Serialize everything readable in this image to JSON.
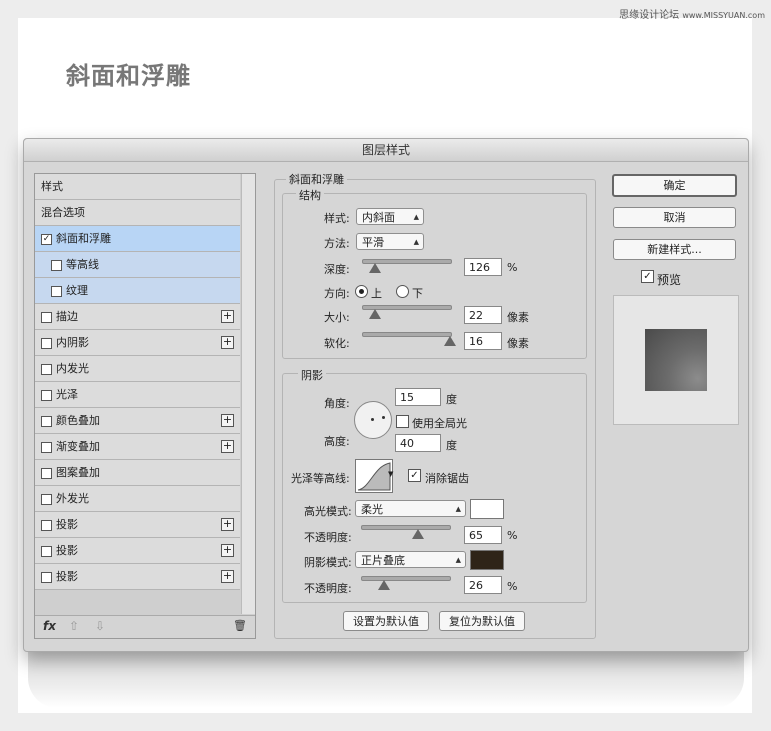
{
  "watermark": {
    "site": "思缘设计论坛",
    "url": "www.MISSYUAN.com"
  },
  "page_heading": "斜面和浮雕",
  "dialog": {
    "title": "图层样式",
    "styles": [
      {
        "label": "样式",
        "checkbox": false,
        "plus": false
      },
      {
        "label": "混合选项",
        "checkbox": false,
        "plus": false
      },
      {
        "label": "斜面和浮雕",
        "checkbox": true,
        "checked": true,
        "plus": false,
        "selected": true
      },
      {
        "label": "等高线",
        "checkbox": true,
        "checked": false,
        "plus": false,
        "sub": true
      },
      {
        "label": "纹理",
        "checkbox": true,
        "checked": false,
        "plus": false,
        "sub": true
      },
      {
        "label": "描边",
        "checkbox": true,
        "checked": false,
        "plus": true
      },
      {
        "label": "内阴影",
        "checkbox": true,
        "checked": false,
        "plus": true
      },
      {
        "label": "内发光",
        "checkbox": true,
        "checked": false,
        "plus": false
      },
      {
        "label": "光泽",
        "checkbox": true,
        "checked": false,
        "plus": false
      },
      {
        "label": "颜色叠加",
        "checkbox": true,
        "checked": false,
        "plus": true
      },
      {
        "label": "渐变叠加",
        "checkbox": true,
        "checked": false,
        "plus": true
      },
      {
        "label": "图案叠加",
        "checkbox": true,
        "checked": false,
        "plus": false
      },
      {
        "label": "外发光",
        "checkbox": true,
        "checked": false,
        "plus": false
      },
      {
        "label": "投影",
        "checkbox": true,
        "checked": false,
        "plus": true
      },
      {
        "label": "投影",
        "checkbox": true,
        "checked": false,
        "plus": true
      },
      {
        "label": "投影",
        "checkbox": true,
        "checked": false,
        "plus": true
      }
    ],
    "footer": {
      "fx": "fx",
      "up": "⇧",
      "down": "⇩",
      "trash": "🗑"
    },
    "bevel": {
      "group_title": "斜面和浮雕",
      "structure_title": "结构",
      "style_label": "样式:",
      "style_value": "内斜面",
      "method_label": "方法:",
      "method_value": "平滑",
      "depth_label": "深度:",
      "depth_value": "126",
      "depth_unit": "%",
      "depth_slider": 0.15,
      "direction_label": "方向:",
      "direction_up": "上",
      "direction_down": "下",
      "direction_selected": "上",
      "size_label": "大小:",
      "size_value": "22",
      "size_unit": "像素",
      "size_slider": 0.15,
      "soften_label": "软化:",
      "soften_value": "16",
      "soften_unit": "像素",
      "soften_slider": 1.0
    },
    "shading": {
      "title": "阴影",
      "angle_label": "角度:",
      "angle_value": "15",
      "angle_unit": "度",
      "global_light_label": "使用全局光",
      "global_light_checked": false,
      "altitude_label": "高度:",
      "altitude_value": "40",
      "altitude_unit": "度",
      "gloss_contour_label": "光泽等高线:",
      "antialias_label": "消除锯齿",
      "antialias_checked": true,
      "highlight_mode_label": "高光模式:",
      "highlight_mode_value": "柔光",
      "highlight_color": "#ffffff",
      "highlight_opacity_label": "不透明度:",
      "highlight_opacity_value": "65",
      "highlight_opacity_unit": "%",
      "highlight_opacity_slider": 0.65,
      "shadow_mode_label": "阴影模式:",
      "shadow_mode_value": "正片叠底",
      "shadow_color": "#2e2418",
      "shadow_opacity_label": "不透明度:",
      "shadow_opacity_value": "26",
      "shadow_opacity_unit": "%",
      "shadow_opacity_slider": 0.26
    },
    "buttons": {
      "make_default": "设置为默认值",
      "reset_default": "复位为默认值",
      "ok": "确定",
      "cancel": "取消",
      "new_style": "新建样式...",
      "preview_label": "预览",
      "preview_checked": true
    }
  }
}
